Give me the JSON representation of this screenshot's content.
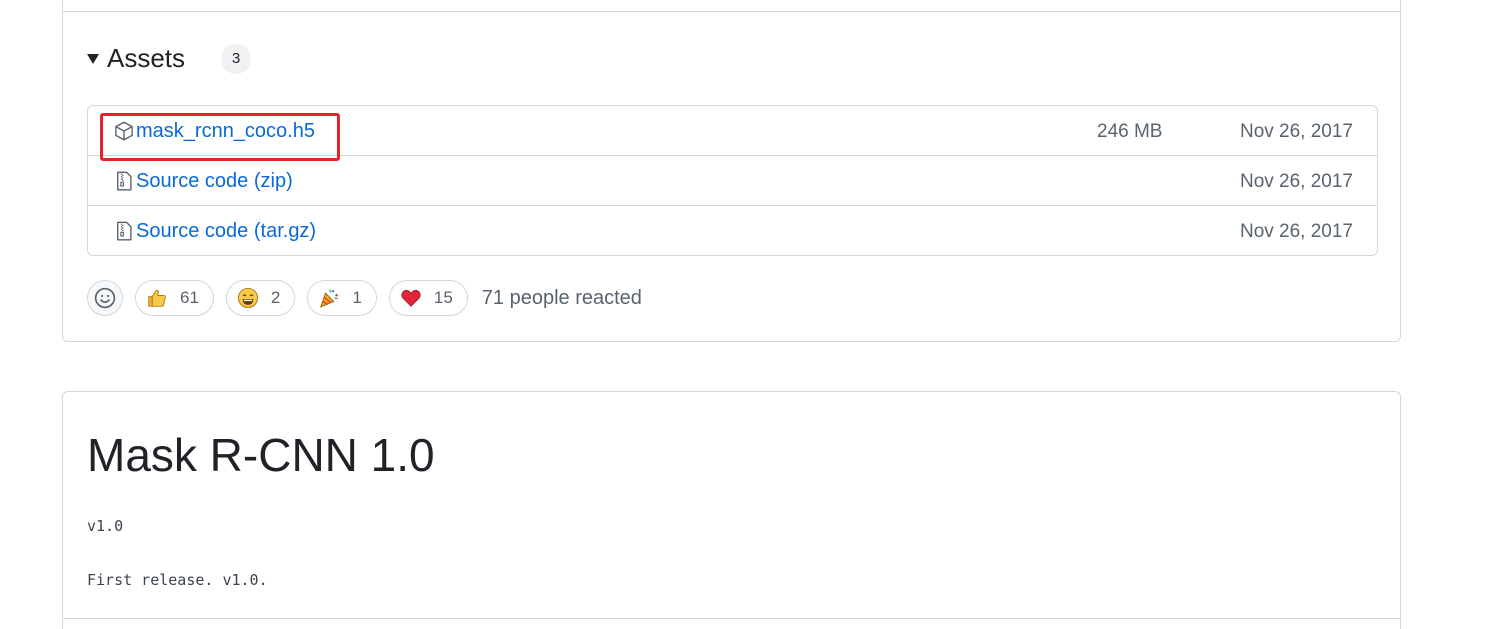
{
  "assets": {
    "title": "Assets",
    "count": "3",
    "items": [
      {
        "name": "mask_rcnn_coco.h5",
        "suffix": "",
        "size": "246 MB",
        "date": "Nov 26, 2017",
        "icon": "package-icon"
      },
      {
        "name": "Source code",
        "suffix": "(zip)",
        "size": "",
        "date": "Nov 26, 2017",
        "icon": "file-zip-icon"
      },
      {
        "name": "Source code",
        "suffix": "(tar.gz)",
        "size": "",
        "date": "Nov 26, 2017",
        "icon": "file-zip-icon"
      }
    ]
  },
  "reactions": {
    "items": [
      {
        "emoji": "thumbs-up",
        "count": "61"
      },
      {
        "emoji": "laugh",
        "count": "2"
      },
      {
        "emoji": "hooray",
        "count": "1"
      },
      {
        "emoji": "heart",
        "count": "15"
      }
    ],
    "summary": "71 people reacted"
  },
  "release": {
    "title": "Mask R-CNN 1.0",
    "tag": "v1.0",
    "body": "First release. v1.0."
  },
  "colors": {
    "link": "#0969da",
    "highlight": "#e5252a",
    "border": "#d0d7de",
    "muted": "#59636e"
  }
}
